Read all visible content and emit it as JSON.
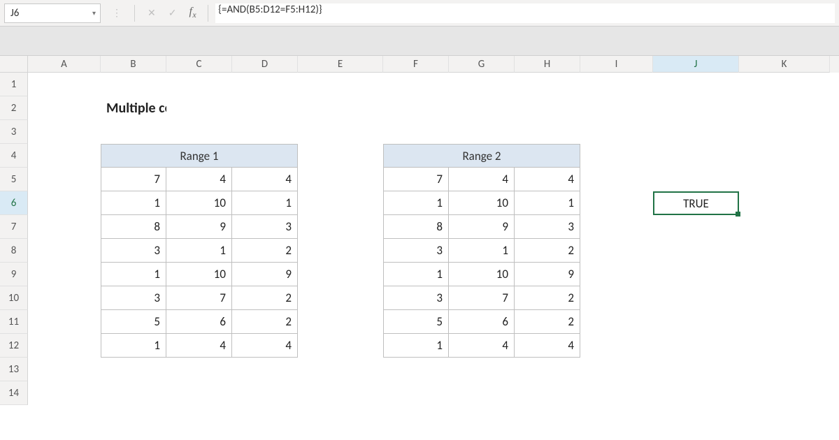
{
  "name_box": "J6",
  "formula": "{=AND(B5:D12=F5:H12)}",
  "columns": [
    "A",
    "B",
    "C",
    "D",
    "E",
    "F",
    "G",
    "H",
    "I",
    "J",
    "K"
  ],
  "active_col": "J",
  "active_row": 6,
  "title": "Multiple cells are equal",
  "range1_header": "Range 1",
  "range2_header": "Range 2",
  "range1": [
    [
      7,
      4,
      4
    ],
    [
      1,
      10,
      1
    ],
    [
      8,
      9,
      3
    ],
    [
      3,
      1,
      2
    ],
    [
      1,
      10,
      9
    ],
    [
      3,
      7,
      2
    ],
    [
      5,
      6,
      2
    ],
    [
      1,
      4,
      4
    ]
  ],
  "range2": [
    [
      7,
      4,
      4
    ],
    [
      1,
      10,
      1
    ],
    [
      8,
      9,
      3
    ],
    [
      3,
      1,
      2
    ],
    [
      1,
      10,
      9
    ],
    [
      3,
      7,
      2
    ],
    [
      5,
      6,
      2
    ],
    [
      1,
      4,
      4
    ]
  ],
  "result": "TRUE",
  "chart_data": {
    "type": "table",
    "title": "Multiple cells are equal",
    "tables": [
      {
        "name": "Range 1",
        "cols": [
          "B",
          "C",
          "D"
        ],
        "rows": [
          [
            7,
            4,
            4
          ],
          [
            1,
            10,
            1
          ],
          [
            8,
            9,
            3
          ],
          [
            3,
            1,
            2
          ],
          [
            1,
            10,
            9
          ],
          [
            3,
            7,
            2
          ],
          [
            5,
            6,
            2
          ],
          [
            1,
            4,
            4
          ]
        ]
      },
      {
        "name": "Range 2",
        "cols": [
          "F",
          "G",
          "H"
        ],
        "rows": [
          [
            7,
            4,
            4
          ],
          [
            1,
            10,
            1
          ],
          [
            8,
            9,
            3
          ],
          [
            3,
            1,
            2
          ],
          [
            1,
            10,
            9
          ],
          [
            3,
            7,
            2
          ],
          [
            5,
            6,
            2
          ],
          [
            1,
            4,
            4
          ]
        ]
      }
    ],
    "formula_cell": {
      "address": "J6",
      "formula": "{=AND(B5:D12=F5:H12)}",
      "value": "TRUE"
    }
  }
}
